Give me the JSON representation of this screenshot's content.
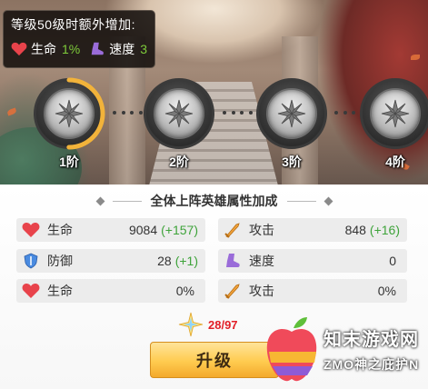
{
  "tooltip": {
    "title": "等级50级时额外增加:",
    "hp_label": "生命",
    "hp_value": "1%",
    "speed_label": "速度",
    "speed_value": "3"
  },
  "tiers": [
    {
      "label": "1阶",
      "progress": 0.5
    },
    {
      "label": "2阶",
      "progress": 0
    },
    {
      "label": "3阶",
      "progress": 0
    },
    {
      "label": "4阶",
      "progress": 0
    }
  ],
  "panel": {
    "title": "全体上阵英雄属性加成",
    "rows": [
      {
        "icon": "heart-icon",
        "name": "生命",
        "value": "9084",
        "bonus": "(+157)"
      },
      {
        "icon": "sword-icon",
        "name": "攻击",
        "value": "848",
        "bonus": "(+16)"
      },
      {
        "icon": "shield-icon",
        "name": "防御",
        "value": "28",
        "bonus": "(+1)"
      },
      {
        "icon": "boot-icon",
        "name": "速度",
        "value": "0",
        "bonus": ""
      },
      {
        "icon": "heart-icon",
        "name": "生命",
        "value": "0%",
        "bonus": ""
      },
      {
        "icon": "sword-icon",
        "name": "攻击",
        "value": "0%",
        "bonus": ""
      }
    ]
  },
  "exp": {
    "count": "28/97"
  },
  "upgrade_label": "升级",
  "watermark": {
    "brand": "知末游戏网",
    "sub": "ZMO神之庇护N"
  },
  "colors": {
    "bonus_green": "#3ea33a",
    "tooltip_value_green": "#7ecb3a",
    "exp_red": "#e21e27",
    "button_gold": "#ffcb4f",
    "progress_gold": "#f2b33a"
  }
}
